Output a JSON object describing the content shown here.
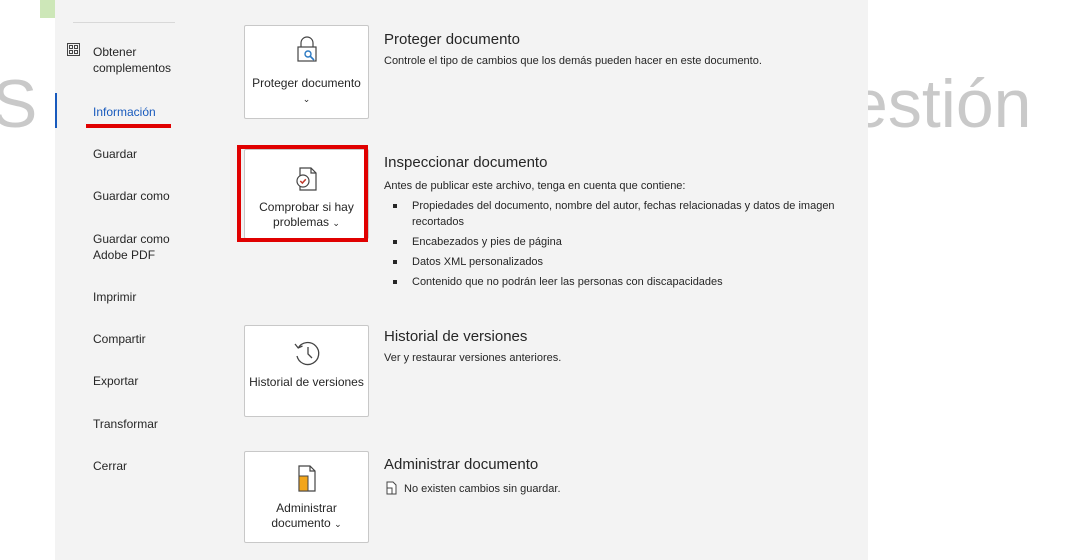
{
  "nav": {
    "items": [
      {
        "label": "Obtener complementos"
      },
      {
        "label": "Información"
      },
      {
        "label": "Guardar"
      },
      {
        "label": "Guardar como"
      },
      {
        "label": "Guardar como Adobe PDF"
      },
      {
        "label": "Imprimir"
      },
      {
        "label": "Compartir"
      },
      {
        "label": "Exportar"
      },
      {
        "label": "Transformar"
      },
      {
        "label": "Cerrar"
      }
    ],
    "active": "Información"
  },
  "watermark": {
    "left_letter": "S",
    "right_text": "estión"
  },
  "sections": {
    "protect": {
      "button_label": "Proteger documento",
      "title": "Proteger documento",
      "text": "Controle el tipo de cambios que los demás pueden hacer en este documento."
    },
    "inspect": {
      "button_label": "Comprobar si hay problemas",
      "title": "Inspeccionar documento",
      "text": "Antes de publicar este archivo, tenga en cuenta que contiene:",
      "bullets": [
        "Propiedades del documento, nombre del autor, fechas relacionadas y datos de imagen recortados",
        "Encabezados y pies de página",
        "Datos XML personalizados",
        "Contenido que no podrán leer las personas con discapacidades"
      ]
    },
    "history": {
      "button_label": "Historial de versiones",
      "title": "Historial de versiones",
      "text": "Ver y restaurar versiones anteriores."
    },
    "manage": {
      "button_label": "Administrar documento",
      "title": "Administrar documento",
      "text": "No existen cambios sin guardar."
    }
  },
  "colors": {
    "accent": "#185abd",
    "highlight": "#e00000",
    "panel": "#f3f3f3"
  }
}
